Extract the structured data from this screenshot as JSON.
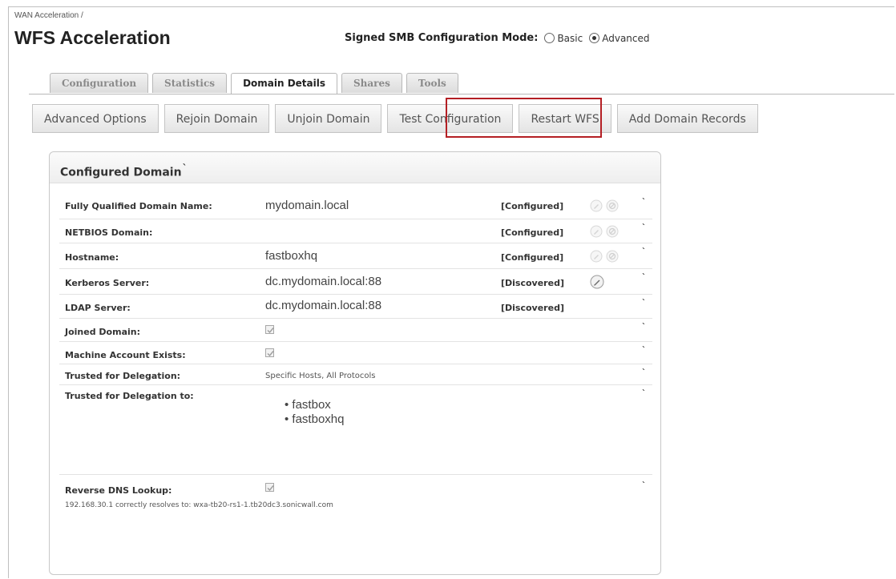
{
  "breadcrumb": "WAN Acceleration /",
  "page_title": "WFS Acceleration",
  "smb_mode": {
    "label": "Signed SMB Configuration Mode:",
    "options": [
      {
        "label": "Basic",
        "selected": false
      },
      {
        "label": "Advanced",
        "selected": true
      }
    ]
  },
  "tabs": [
    {
      "label": "Configuration",
      "active": false
    },
    {
      "label": "Statistics",
      "active": false
    },
    {
      "label": "Domain Details",
      "active": true
    },
    {
      "label": "Shares",
      "active": false
    },
    {
      "label": "Tools",
      "active": false
    }
  ],
  "sub_buttons": [
    {
      "label": "Advanced Options"
    },
    {
      "label": "Rejoin Domain"
    },
    {
      "label": "Unjoin Domain"
    },
    {
      "label": "Test Configuration",
      "highlighted": true
    },
    {
      "label": "Restart WFS"
    },
    {
      "label": "Add Domain Records"
    }
  ],
  "highlight_color": "#b41f24",
  "panel": {
    "title": "Configured Domain",
    "title_mark": "`",
    "rows": [
      {
        "label": "Fully Qualified Domain Name:",
        "value": "mydomain.local",
        "status": "[Configured]",
        "icons": "edit-disabled,clear-disabled"
      },
      {
        "label": "NETBIOS Domain:",
        "value": "",
        "status": "[Configured]",
        "icons": "edit-disabled,clear-disabled"
      },
      {
        "label": "Hostname:",
        "value": "fastboxhq",
        "status": "[Configured]",
        "icons": "edit-disabled,clear-disabled"
      },
      {
        "label": "Kerberos Server:",
        "value": "dc.mydomain.local:88",
        "status": "[Discovered]",
        "icons": "edit"
      },
      {
        "label": "LDAP Server:",
        "value": "dc.mydomain.local:88",
        "status": "[Discovered]"
      },
      {
        "label": "Joined Domain:",
        "checked": true
      },
      {
        "label": "Machine Account Exists:",
        "checked": true
      },
      {
        "label": "Trusted for Delegation:",
        "value": "Specific Hosts, All Protocols"
      },
      {
        "label": "Trusted for Delegation to:",
        "list": [
          "fastbox",
          "fastboxhq"
        ]
      },
      {
        "label": "Reverse DNS Lookup:",
        "checked": true,
        "note": "192.168.30.1 correctly resolves to: wxa-tb20-rs1-1.tb20dc3.sonicwall.com"
      }
    ],
    "row_tick": "`"
  }
}
